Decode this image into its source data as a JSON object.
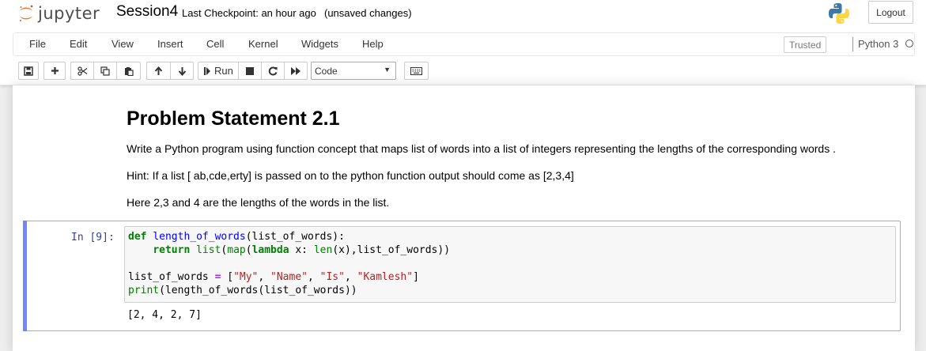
{
  "header": {
    "logo_text": "jupyter",
    "notebook_name": "Session4",
    "checkpoint": "Last Checkpoint: an hour ago",
    "unsaved": "(unsaved changes)",
    "logout_label": "Logout"
  },
  "menubar": {
    "items": [
      "File",
      "Edit",
      "View",
      "Insert",
      "Cell",
      "Kernel",
      "Widgets",
      "Help"
    ],
    "trusted_label": "Trusted",
    "kernel_name": "Python 3"
  },
  "toolbar": {
    "run_label": "Run",
    "cell_type": "Code",
    "icons": [
      "save-icon",
      "plus-icon",
      "cut-icon",
      "copy-icon",
      "paste-icon",
      "arrow-up-icon",
      "arrow-down-icon",
      "step-forward-icon",
      "stop-icon",
      "restart-icon",
      "fast-forward-icon",
      "keyboard-icon"
    ]
  },
  "markdown_cell": {
    "title": "Problem Statement 2.1",
    "paragraphs": [
      "Write a Python program using function concept that maps list of words into a list of integers representing the lengths of the corresponding words .",
      "Hint: If a list [ ab,cde,erty] is passed on to the python function output should come as [2,3,4]",
      "Here 2,3 and 4 are the lengths of the words in the list."
    ]
  },
  "code_cell": {
    "prompt": "In [9]:",
    "lines": [
      "def length_of_words(list_of_words):",
      "    return list(map(lambda x: len(x),list_of_words))",
      "",
      "list_of_words = [\"My\", \"Name\", \"Is\", \"Kamlesh\"]",
      "print(length_of_words(list_of_words))"
    ],
    "output": "[2, 4, 2, 7]"
  },
  "colors": {
    "cell_selected_bar": "#6f88f7",
    "prompt_in": "#303f9f",
    "keyword": "#008000",
    "string": "#ba2121",
    "function_def": "#0000ff"
  }
}
